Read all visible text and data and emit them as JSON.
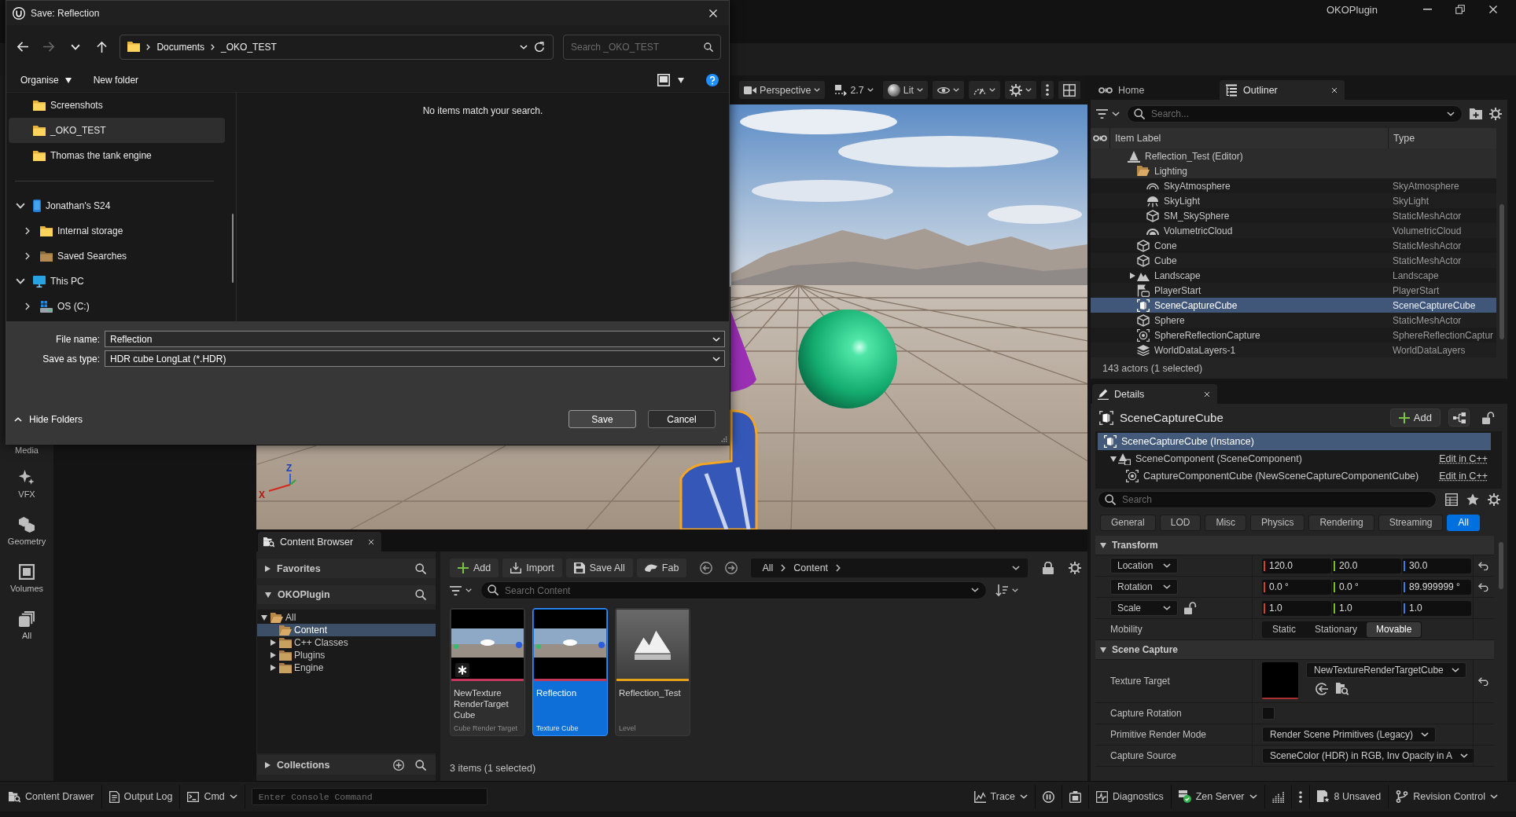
{
  "window": {
    "title": "OKOPlugin"
  },
  "place_actors": [
    {
      "label": "Media",
      "kind": "media"
    },
    {
      "label": "VFX",
      "kind": "vfx"
    },
    {
      "label": "Geometry",
      "kind": "geometry"
    },
    {
      "label": "Volumes",
      "kind": "volumes"
    },
    {
      "label": "All",
      "kind": "all"
    }
  ],
  "viewport": {
    "toolbar": [
      {
        "kind": "camera",
        "label": "Perspective",
        "dropdown": true
      },
      {
        "kind": "speed",
        "label": "2.7",
        "dropdown": true
      },
      {
        "kind": "lit",
        "label": "Lit",
        "dropdown": true
      },
      {
        "kind": "eye",
        "dropdown": true
      },
      {
        "kind": "gauge",
        "dropdown": true
      },
      {
        "kind": "gear",
        "dropdown": true
      },
      {
        "kind": "kebab",
        "dropdown": false
      },
      {
        "kind": "layout",
        "dropdown": false
      }
    ],
    "axis_gizmo": {
      "up": "Z",
      "side": "X"
    }
  },
  "outliner": {
    "tabs": [
      {
        "label": "Home",
        "kind": "home",
        "selected": false,
        "closable": false
      },
      {
        "label": "Outliner",
        "kind": "outliner",
        "selected": true,
        "closable": true
      }
    ],
    "search": {
      "placeholder": "Search..."
    },
    "columns": [
      "Item Label",
      "Type"
    ],
    "rows": [
      {
        "label": "Reflection_Test (Editor)",
        "kind": "level",
        "pinned": true,
        "selected": false,
        "children": [
          {
            "label": "Lighting",
            "kind": "folder",
            "pinned": true,
            "selected": false,
            "children": [
              {
                "label": "SkyAtmosphere",
                "type": "SkyAtmosphere",
                "kind": "atmosphere",
                "pinned": false,
                "selected": false
              },
              {
                "label": "SkyLight",
                "type": "SkyLight",
                "kind": "skylight",
                "pinned": false,
                "selected": false
              },
              {
                "label": "SM_SkySphere",
                "type": "StaticMeshActor",
                "kind": "mesh",
                "pinned": false,
                "selected": false
              },
              {
                "label": "VolumetricCloud",
                "type": "VolumetricCloud",
                "kind": "cloud",
                "pinned": false,
                "selected": false
              }
            ]
          },
          {
            "label": "Cone",
            "type": "StaticMeshActor",
            "kind": "mesh",
            "pinned": false,
            "selected": false
          },
          {
            "label": "Cube",
            "type": "StaticMeshActor",
            "kind": "mesh",
            "pinned": false,
            "selected": false
          },
          {
            "label": "Landscape",
            "type": "Landscape",
            "kind": "landscape",
            "pinned": false,
            "selected": false,
            "expanded": false
          },
          {
            "label": "PlayerStart",
            "type": "PlayerStart",
            "kind": "playerstart",
            "pinned": false,
            "selected": false
          },
          {
            "label": "SceneCaptureCube",
            "type": "SceneCaptureCube",
            "kind": "capture",
            "pinned": false,
            "selected": true
          },
          {
            "label": "Sphere",
            "type": "StaticMeshActor",
            "kind": "mesh",
            "pinned": false,
            "selected": false
          },
          {
            "label": "SphereReflectionCapture",
            "type": "SphereReflectionCaptur",
            "kind": "reflection",
            "pinned": false,
            "selected": false
          },
          {
            "label": "WorldDataLayers-1",
            "type": "WorldDataLayers",
            "kind": "layers",
            "pinned": false,
            "selected": false
          }
        ]
      }
    ],
    "status": "143 actors (1 selected)"
  },
  "details": {
    "tab": {
      "label": "Details",
      "selected": true,
      "closable": true
    },
    "title": "SceneCaptureCube",
    "add_button": "Add",
    "instance": {
      "label": "SceneCaptureCube (Instance)",
      "kind": "capture",
      "selected": true
    },
    "components": [
      {
        "label": "SceneComponent (SceneComponent)",
        "kind": "scene",
        "link": "Edit in C++",
        "expanded": true,
        "selected": false,
        "children": [
          {
            "label": "CaptureComponentCube (NewSceneCaptureComponentCube)",
            "kind": "capture_component",
            "link": "Edit in C++",
            "selected": false
          }
        ]
      }
    ],
    "search": {
      "placeholder": "Search"
    },
    "filters": [
      {
        "label": "General",
        "selected": false
      },
      {
        "label": "LOD",
        "selected": false
      },
      {
        "label": "Misc",
        "selected": false
      },
      {
        "label": "Physics",
        "selected": false
      },
      {
        "label": "Rendering",
        "selected": false
      },
      {
        "label": "Streaming",
        "selected": false
      },
      {
        "label": "All",
        "selected": true
      }
    ],
    "sections": [
      {
        "title": "Transform",
        "expanded": true,
        "rows": [
          {
            "kind": "vector",
            "label": "Location",
            "values": [
              {
                "text": "120.0",
                "color": "#d8401e"
              },
              {
                "text": "20.0",
                "color": "#7fba1f"
              },
              {
                "text": "30.0",
                "color": "#2f7fe6"
              }
            ],
            "resettable": true
          },
          {
            "kind": "vector",
            "label": "Rotation",
            "values": [
              {
                "text": "0.0 °",
                "color": "#d8401e"
              },
              {
                "text": "0.0 °",
                "color": "#7fba1f"
              },
              {
                "text": "89.999999 °",
                "color": "#2f7fe6"
              }
            ],
            "resettable": true
          },
          {
            "kind": "vector",
            "label": "Scale",
            "locked": false,
            "values": [
              {
                "text": "1.0",
                "color": "#d8401e"
              },
              {
                "text": "1.0",
                "color": "#7fba1f"
              },
              {
                "text": "1.0",
                "color": "#2f7fe6"
              }
            ],
            "resettable": false
          },
          {
            "kind": "segmented",
            "label": "Mobility",
            "options": [
              {
                "label": "Static",
                "selected": false
              },
              {
                "label": "Stationary",
                "selected": false
              },
              {
                "label": "Movable",
                "selected": true
              }
            ],
            "resettable": false
          }
        ]
      },
      {
        "title": "Scene Capture",
        "expanded": true,
        "rows": [
          {
            "kind": "asset",
            "label": "Texture Target",
            "value": "NewTextureRenderTargetCube",
            "resettable": true
          },
          {
            "kind": "checkbox",
            "label": "Capture Rotation",
            "checked": false,
            "resettable": false
          },
          {
            "kind": "dropdown",
            "label": "Primitive Render Mode",
            "value": "Render Scene Primitives (Legacy)",
            "resettable": false
          },
          {
            "kind": "dropdown",
            "label": "Capture Source",
            "value": "SceneColor (HDR) in RGB, Inv Opacity in A",
            "resettable": false
          }
        ]
      }
    ]
  },
  "content_browser": {
    "tab": {
      "label": "Content Browser",
      "selected": true,
      "closable": true
    },
    "favorites": {
      "label": "Favorites",
      "expanded": false
    },
    "project": {
      "label": "OKOPlugin",
      "expanded": true,
      "folders": [
        {
          "label": "All",
          "expanded": true,
          "selected": false,
          "children": [
            {
              "label": "Content",
              "selected": true
            },
            {
              "label": "C++ Classes",
              "expanded": false,
              "selected": false
            },
            {
              "label": "Plugins",
              "expanded": false,
              "selected": false
            },
            {
              "label": "Engine",
              "expanded": false,
              "selected": false
            }
          ]
        }
      ]
    },
    "collections": {
      "label": "Collections",
      "expanded": false
    },
    "toolbar": [
      {
        "label": "Add",
        "kind": "add"
      },
      {
        "label": "Import",
        "kind": "import"
      },
      {
        "label": "Save All",
        "kind": "save"
      },
      {
        "label": "Fab",
        "kind": "fab"
      }
    ],
    "path": [
      "All",
      "Content"
    ],
    "search": {
      "placeholder": "Search Content"
    },
    "assets": [
      {
        "name": "NewTexture RenderTarget Cube",
        "type": "Cube Render Target",
        "kind": "panorama",
        "color": "#c2375b",
        "selected": false,
        "unsaved": true
      },
      {
        "name": "Reflection",
        "type": "Texture Cube",
        "kind": "panorama",
        "color": "#c2375b",
        "selected": true,
        "unsaved": false
      },
      {
        "name": "Reflection_Test",
        "type": "Level",
        "kind": "level",
        "color": "#e3a21a",
        "selected": false,
        "unsaved": false
      }
    ],
    "status": "3 items (1 selected)"
  },
  "status_bar": {
    "left": [
      {
        "kind": "drawer",
        "label": "Content Drawer",
        "dropdown": false
      },
      {
        "kind": "log",
        "label": "Output Log",
        "dropdown": false
      },
      {
        "kind": "cmd",
        "label": "Cmd",
        "dropdown": true
      }
    ],
    "console": {
      "placeholder": "Enter Console Command"
    },
    "right": [
      {
        "kind": "trace",
        "label": "Trace",
        "dropdown": true
      },
      {
        "kind": "pause",
        "dropdown": false
      },
      {
        "kind": "snapshot",
        "dropdown": false
      },
      {
        "kind": "diagnostics",
        "label": "Diagnostics",
        "dropdown": false
      },
      {
        "kind": "zen",
        "label": "Zen Server",
        "dropdown": true
      },
      {
        "kind": "bars",
        "dropdown": false
      },
      {
        "kind": "kebab",
        "dropdown": false
      },
      {
        "kind": "unsaved",
        "label": "8 Unsaved",
        "dropdown": false
      },
      {
        "kind": "revision",
        "label": "Revision Control",
        "dropdown": true
      }
    ]
  },
  "dialog": {
    "title": "Save: Reflection",
    "nav": [
      {
        "kind": "back",
        "disabled": false
      },
      {
        "kind": "forward",
        "disabled": true
      },
      {
        "kind": "recent",
        "disabled": false
      },
      {
        "kind": "up",
        "disabled": false
      }
    ],
    "breadcrumb": [
      "Documents",
      "_OKO_TEST"
    ],
    "search": {
      "placeholder": "Search _OKO_TEST"
    },
    "commands": [
      {
        "label": "Organise",
        "dropdown": true
      },
      {
        "label": "New folder",
        "dropdown": false
      }
    ],
    "quick_access": [
      {
        "label": "Screenshots",
        "kind": "folder",
        "selected": false
      },
      {
        "label": "_OKO_TEST",
        "kind": "folder",
        "selected": true
      },
      {
        "label": "Thomas the tank engine",
        "kind": "folder",
        "selected": false
      }
    ],
    "locations": [
      {
        "label": "Jonathan's S24",
        "kind": "phone",
        "expanded": true,
        "selected": false,
        "children": [
          {
            "label": "Internal storage",
            "kind": "folder",
            "expanded": false,
            "selected": false
          },
          {
            "label": "Saved Searches",
            "kind": "searches",
            "expanded": false,
            "selected": false
          }
        ]
      },
      {
        "label": "This PC",
        "kind": "pc",
        "expanded": true,
        "selected": false,
        "children": [
          {
            "label": "OS (C:)",
            "kind": "drive",
            "expanded": false,
            "selected": false
          }
        ]
      }
    ],
    "message": "No items match your search.",
    "fields": [
      {
        "label": "File name:",
        "value": "Reflection"
      },
      {
        "label": "Save as type:",
        "value": "HDR cube LongLat (*.HDR)"
      }
    ],
    "hide_folders": "Hide Folders",
    "buttons": [
      {
        "label": "Save",
        "kind": "primary"
      },
      {
        "label": "Cancel",
        "kind": "secondary"
      }
    ]
  }
}
